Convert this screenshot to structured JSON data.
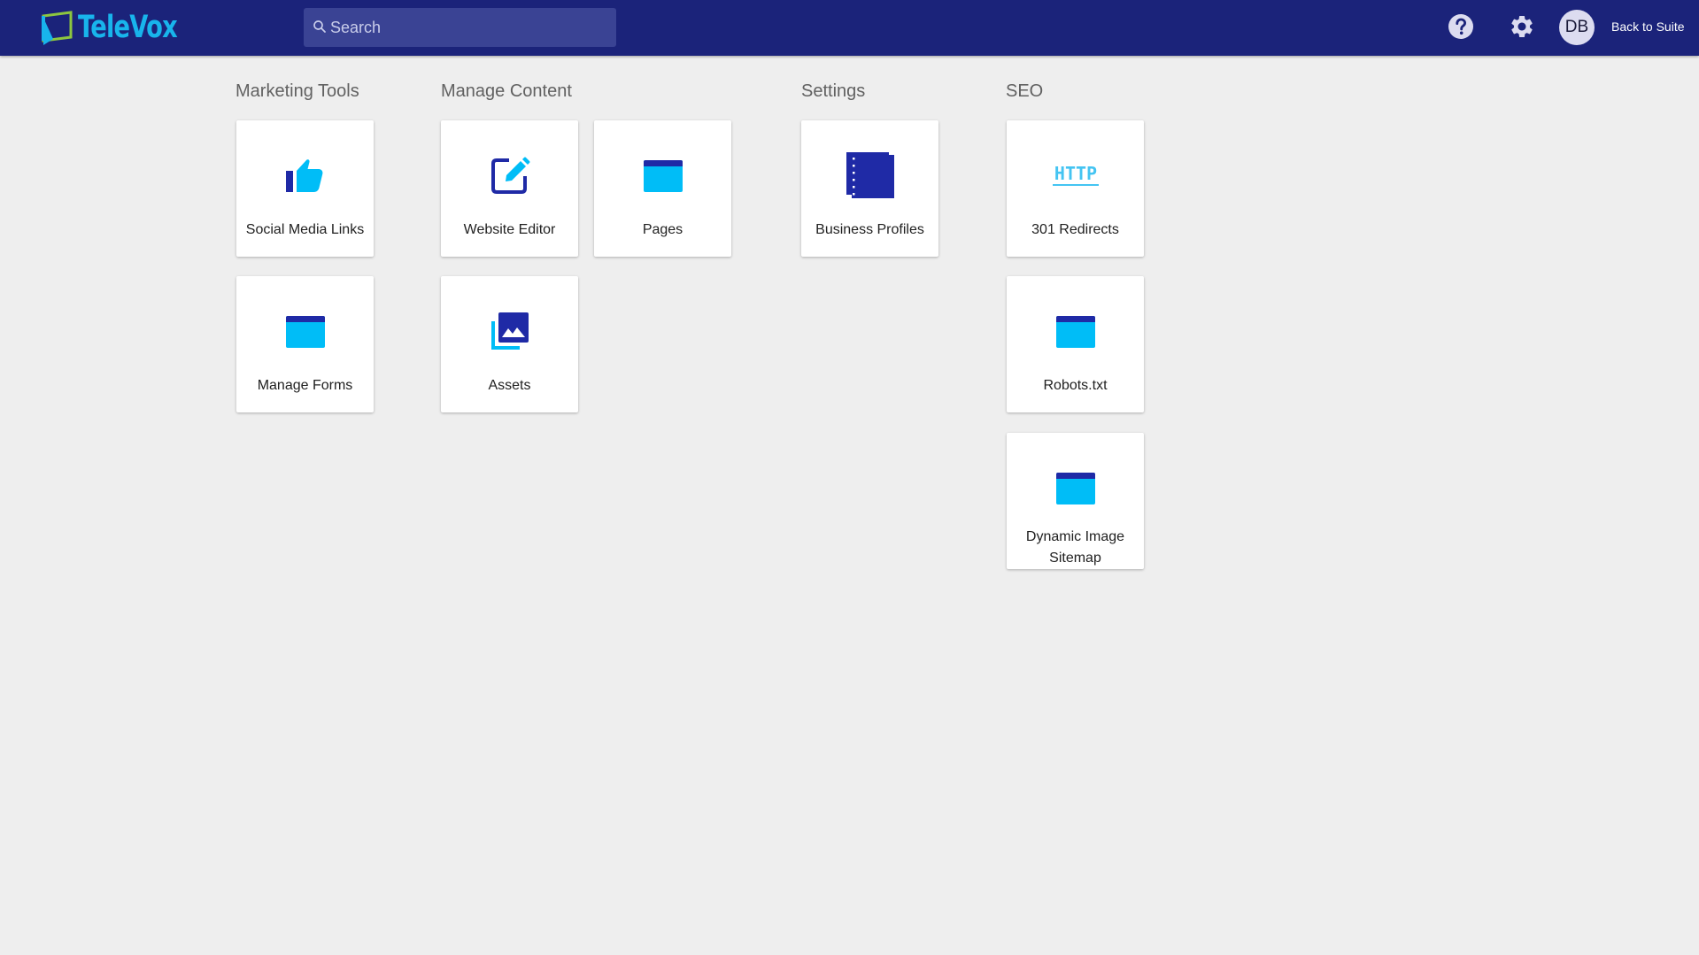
{
  "header": {
    "logo_text": "TeleVox",
    "search_placeholder": "Search",
    "user_initials": "DB",
    "back_link": "Back to Suite"
  },
  "sections": {
    "marketing_tools": {
      "title": "Marketing Tools",
      "tiles": [
        {
          "label": "Social Media Links",
          "icon": "thumbs-up-icon"
        },
        {
          "label": "Manage Forms",
          "icon": "window-icon"
        }
      ]
    },
    "manage_content": {
      "title": "Manage Content",
      "tiles": [
        {
          "label": "Website Editor",
          "icon": "edit-icon"
        },
        {
          "label": "Pages",
          "icon": "window-icon"
        },
        {
          "label": "Assets",
          "icon": "image-library-icon"
        }
      ]
    },
    "settings": {
      "title": "Settings",
      "tiles": [
        {
          "label": "Business Profiles",
          "icon": "notebook-icon"
        }
      ]
    },
    "seo": {
      "title": "SEO",
      "tiles": [
        {
          "label": "301 Redirects",
          "icon": "http-icon"
        },
        {
          "label": "Robots.txt",
          "icon": "window-icon"
        },
        {
          "label": "Dynamic Image Sitemap",
          "icon": "window-icon"
        }
      ]
    }
  },
  "colors": {
    "header_bg": "#1b237a",
    "icon_dark": "#1f2aa6",
    "icon_light": "#00bdf7",
    "page_bg": "#eeeeee"
  }
}
